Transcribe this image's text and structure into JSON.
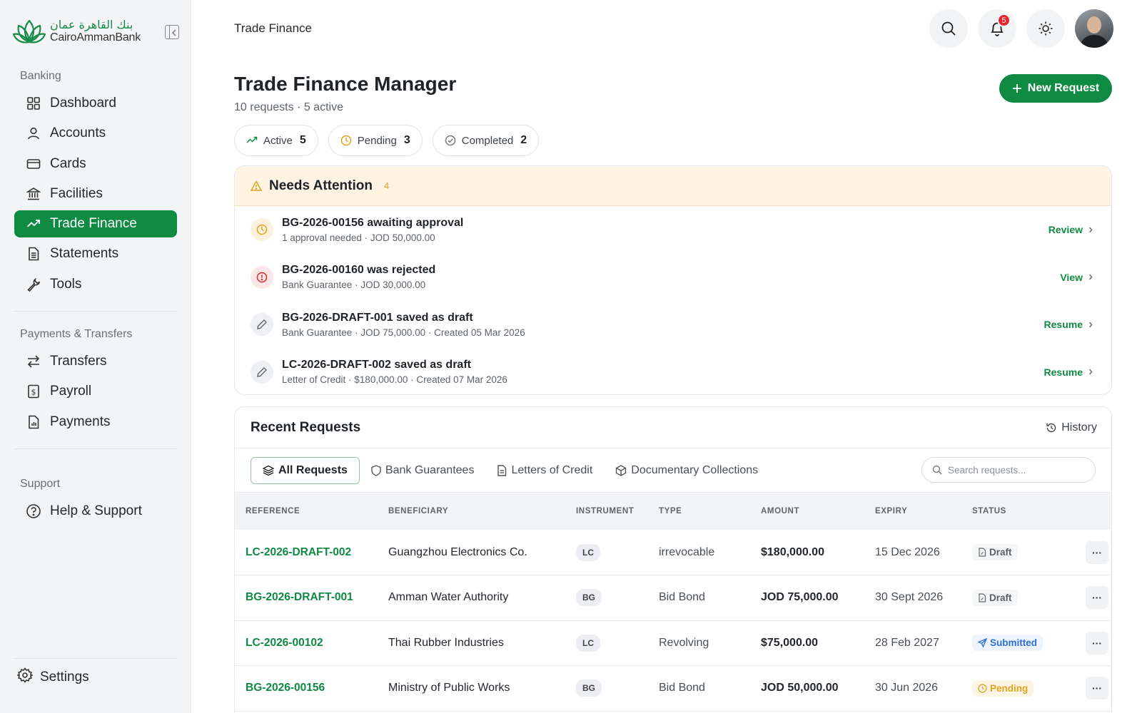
{
  "brand": {
    "arabic": "بنك القاهرة عمان",
    "english": "CairoAmmanBank"
  },
  "sidebar": {
    "banking_label": "Banking",
    "banking_items": [
      {
        "label": "Dashboard",
        "icon": "grid-icon"
      },
      {
        "label": "Accounts",
        "icon": "user-icon"
      },
      {
        "label": "Cards",
        "icon": "card-icon"
      },
      {
        "label": "Facilities",
        "icon": "bank-icon"
      },
      {
        "label": "Trade Finance",
        "icon": "trend-icon",
        "active": true
      },
      {
        "label": "Statements",
        "icon": "document-icon"
      },
      {
        "label": "Tools",
        "icon": "wrench-icon"
      }
    ],
    "payments_label": "Payments & Transfers",
    "payments_items": [
      {
        "label": "Transfers",
        "icon": "transfer-icon"
      },
      {
        "label": "Payroll",
        "icon": "payroll-icon"
      },
      {
        "label": "Payments",
        "icon": "receipt-icon"
      }
    ],
    "support_label": "Support",
    "support_items": [
      {
        "label": "Help & Support",
        "icon": "help-icon"
      }
    ],
    "settings_label": "Settings"
  },
  "topbar": {
    "title": "Trade Finance",
    "notification_count": "5"
  },
  "header": {
    "title": "Trade Finance Manager",
    "subtitle": "10 requests · 5 active",
    "new_request_label": "New Request"
  },
  "chips": [
    {
      "label": "Active",
      "count": "5"
    },
    {
      "label": "Pending",
      "count": "3"
    },
    {
      "label": "Completed",
      "count": "2"
    }
  ],
  "attention": {
    "title": "Needs Attention",
    "count": "4",
    "items": [
      {
        "title": "BG-2026-00156 awaiting approval",
        "sub": "1 approval needed · JOD 50,000.00",
        "action": "Review",
        "kind": "warn"
      },
      {
        "title": "BG-2026-00160 was rejected",
        "sub": "Bank Guarantee · JOD 30,000.00",
        "action": "View",
        "kind": "err"
      },
      {
        "title": "BG-2026-DRAFT-001 saved as draft",
        "sub": "Bank Guarantee · JOD 75,000.00 · Created 05 Mar 2026",
        "action": "Resume",
        "kind": "draft"
      },
      {
        "title": "LC-2026-DRAFT-002 saved as draft",
        "sub": "Letter of Credit · $180,000.00 · Created 07 Mar 2026",
        "action": "Resume",
        "kind": "draft"
      }
    ]
  },
  "recent": {
    "title": "Recent Requests",
    "history_label": "History",
    "tabs": [
      "All Requests",
      "Bank Guarantees",
      "Letters of Credit",
      "Documentary Collections"
    ],
    "search_placeholder": "Search requests...",
    "columns": [
      "REFERENCE",
      "BENEFICIARY",
      "INSTRUMENT",
      "TYPE",
      "AMOUNT",
      "EXPIRY",
      "STATUS"
    ],
    "rows": [
      {
        "ref": "LC-2026-DRAFT-002",
        "beneficiary": "Guangzhou Electronics Co.",
        "instrument": "LC",
        "type": "irrevocable",
        "amount": "$180,000.00",
        "expiry": "15 Dec 2026",
        "status": "Draft",
        "status_kind": "draft"
      },
      {
        "ref": "BG-2026-DRAFT-001",
        "beneficiary": "Amman Water Authority",
        "instrument": "BG",
        "type": "Bid Bond",
        "amount": "JOD 75,000.00",
        "expiry": "30 Sept 2026",
        "status": "Draft",
        "status_kind": "draft"
      },
      {
        "ref": "LC-2026-00102",
        "beneficiary": "Thai Rubber Industries",
        "instrument": "LC",
        "type": "Revolving",
        "amount": "$75,000.00",
        "expiry": "28 Feb 2027",
        "status": "Submitted",
        "status_kind": "submitted"
      },
      {
        "ref": "BG-2026-00156",
        "beneficiary": "Ministry of Public Works",
        "instrument": "BG",
        "type": "Bid Bond",
        "amount": "JOD 50,000.00",
        "expiry": "30 Jun 2026",
        "status": "Pending",
        "status_kind": "pending"
      }
    ]
  },
  "colors": {
    "brand_green": "#0f8a43",
    "warning": "#e3a21a",
    "error": "#e0262f",
    "info": "#2d6fd6"
  }
}
